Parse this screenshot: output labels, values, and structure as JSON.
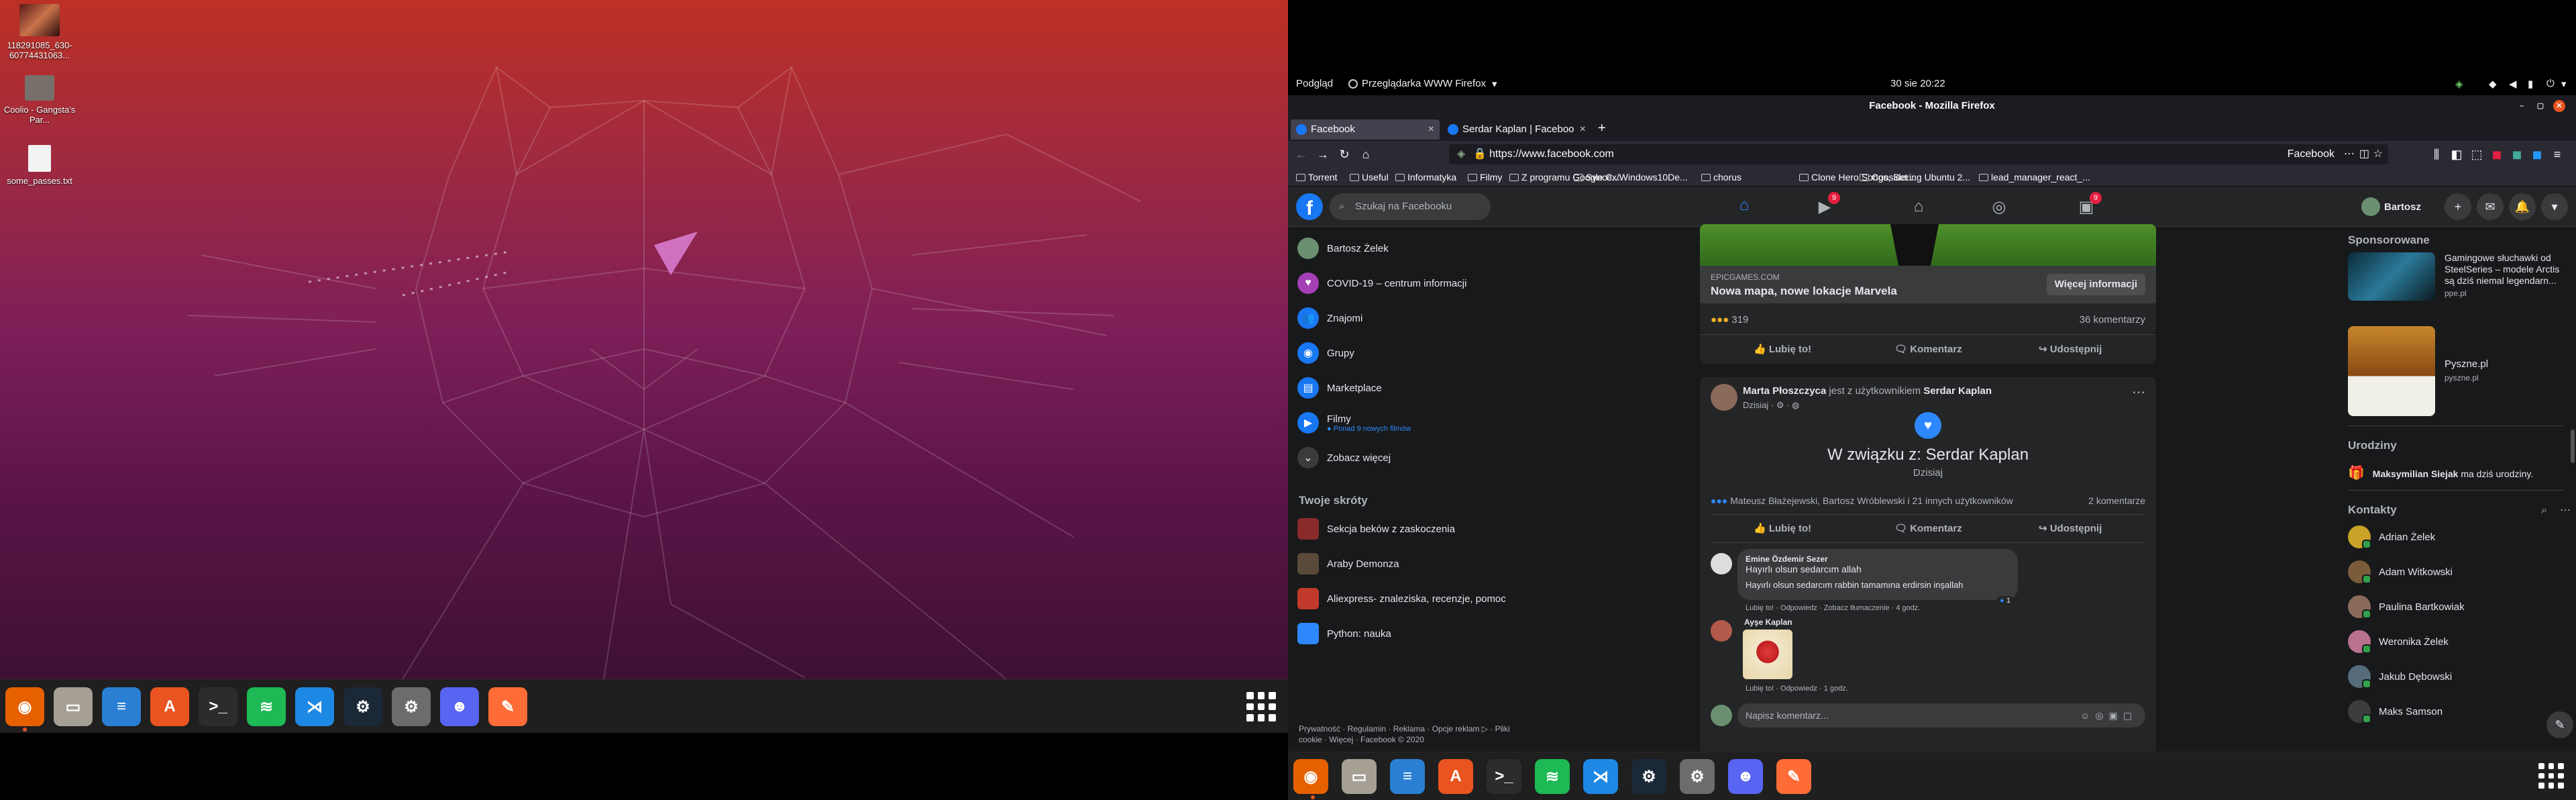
{
  "desktop": {
    "icons": [
      {
        "label": "118291085_630-60774431063...",
        "icon": "image-file-icon"
      },
      {
        "label": "Coolio - Gangsta's Par...",
        "icon": "folder-icon"
      },
      {
        "label": "some_passes.txt",
        "icon": "text-file-icon"
      }
    ]
  },
  "dock": {
    "apps": [
      {
        "name": "firefox",
        "glyph": "◉",
        "color": "#e66000",
        "active": true
      },
      {
        "name": "files",
        "glyph": "▭",
        "color": "#a59f94"
      },
      {
        "name": "libreoffice-writer",
        "glyph": "≡",
        "color": "#2a7fd4"
      },
      {
        "name": "software-center",
        "glyph": "A",
        "color": "#e95420"
      },
      {
        "name": "terminal",
        "glyph": ">_",
        "color": "#2c2c2c"
      },
      {
        "name": "spotify",
        "glyph": "≋",
        "color": "#1db954"
      },
      {
        "name": "vscode",
        "glyph": "⋊",
        "color": "#1e88e5"
      },
      {
        "name": "steam",
        "glyph": "⚙",
        "color": "#1b2838"
      },
      {
        "name": "settings",
        "glyph": "⚙",
        "color": "#6c6c6c"
      },
      {
        "name": "discord",
        "glyph": "☻",
        "color": "#5865f2"
      },
      {
        "name": "postman",
        "glyph": "✎",
        "color": "#ff6c37"
      }
    ]
  },
  "topbar": {
    "activities": "Podgląd",
    "app_menu": "Przeglądarka WWW Firefox",
    "clock": "30 sie  20:22"
  },
  "browser": {
    "window_title": "Facebook - Mozilla Firefox",
    "tabs": [
      {
        "title": "Facebook",
        "active": true
      },
      {
        "title": "Serdar Kaplan | Faceboo",
        "active": false
      }
    ],
    "new_tab": "+",
    "url": "https://www.facebook.com",
    "url_right_label": "Facebook",
    "bookmarks": [
      "Torrent",
      "Useful",
      "Informatyka",
      "Filmy",
      "Z programu Google C...",
      "Syncex/Windows10De...",
      "chorus",
      "Clone Hero Songs, Set...",
      "Considering Ubuntu 2...",
      "lead_manager_react_..."
    ]
  },
  "facebook": {
    "search_placeholder": "Szukaj na Facebooku",
    "nav_badges": {
      "watch": "9",
      "gaming": "9"
    },
    "profile_name": "Bartosz",
    "left_nav": [
      {
        "label": "Bartosz Żelek",
        "icon": "avatar-icon",
        "color": "#6b8f71"
      },
      {
        "label": "COVID-19 – centrum informacji",
        "icon": "heart-icon",
        "color": "#a43fb5"
      },
      {
        "label": "Znajomi",
        "icon": "friends-icon",
        "color": "#1877f2"
      },
      {
        "label": "Grupy",
        "icon": "groups-icon",
        "color": "#1877f2"
      },
      {
        "label": "Marketplace",
        "icon": "shop-icon",
        "color": "#1877f2"
      },
      {
        "label": "Filmy",
        "icon": "video-icon",
        "color": "#1877f2",
        "sub": "● Ponad 9 nowych filmów"
      },
      {
        "label": "Zobacz więcej",
        "icon": "chevron-down-icon",
        "color": "#3a3b3c"
      }
    ],
    "shortcuts_title": "Twoje skróty",
    "shortcuts": [
      "Sekcja beków z zaskoczenia",
      "Araby Demonza",
      "Aliexpress- znaleziska, recenzje, pomoc",
      "Python: nauka"
    ],
    "footer": "Prywatność · Regulamin · Reklama · Opcje reklam ▷ · Pliki cookie · Więcej · Facebook © 2020",
    "post1": {
      "domain": "EPICGAMES.COM",
      "headline": "Nowa mapa, nowe lokacje Marvela",
      "cta": "Więcej informacji",
      "reactions": "319",
      "comments": "36 komentarzy"
    },
    "actions": {
      "like": "Lubię to!",
      "comment": "Komentarz",
      "share": "Udostępnij"
    },
    "post2": {
      "author": "Marta Płoszczyca",
      "with_text": "jest z użytkownikiem",
      "with_name": "Serdar Kaplan",
      "time": "Dzisiaj · ⚙ · ◍",
      "event_title": "W związku z: Serdar Kaplan",
      "event_date": "Dzisiaj",
      "reactors": "Mateusz Błażejewski, Bartosz Wróblewski i 21 innych użytkowników",
      "comments": "2 komentarze",
      "comment1": {
        "author": "Emine Özdemir Sezer",
        "line1": "Hayırlı olsun sedarcım allah",
        "line2": "Hayırlı olsun sedarcım rabbin tamamına erdirsin inşallah",
        "meta": "Lubię to! · Odpowiedz · Zobacz tłumaczenie · 4 godz.",
        "likes": "1"
      },
      "comment2": {
        "author": "Ayşe Kaplan",
        "meta": "Lubię to! · Odpowiedz · 1 godz."
      },
      "write_placeholder": "Napisz komentarz..."
    },
    "sponsored_title": "Sponsorowane",
    "ads": [
      {
        "title": "Gamingowe słuchawki od SteelSeries – modele Arctis są dziś niemal legendarn...",
        "site": "ppe.pl"
      },
      {
        "title": "Pyszne.pl",
        "site": "pyszne.pl"
      }
    ],
    "birthdays_title": "Urodziny",
    "birthday_name": "Maksymilian Siejak",
    "birthday_text": "ma dziś urodziny.",
    "contacts_title": "Kontakty",
    "contacts": [
      {
        "name": "Adrian Żelek",
        "color": "#c9a227"
      },
      {
        "name": "Adam Witkowski",
        "color": "#7a5c3a"
      },
      {
        "name": "Paulina Bartkowiak",
        "color": "#8a6a5a"
      },
      {
        "name": "Weronika Żelek",
        "color": "#b8728f"
      },
      {
        "name": "Jakub Dębowski",
        "color": "#556b7a"
      },
      {
        "name": "Maks Samson",
        "color": "#3d3d3d"
      }
    ]
  }
}
